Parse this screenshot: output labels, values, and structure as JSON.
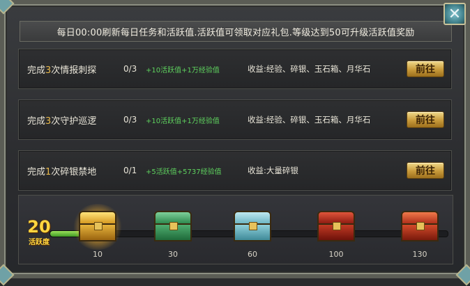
{
  "header": {
    "info_text": "每日00:00刷新每日任务和活跃值.活跃值可领取对应礼包.等级达到50可升级活跃值奖励",
    "close_symbol": "✕"
  },
  "tasks": [
    {
      "prefix": "完成",
      "count": "3",
      "suffix": "次情报刺探",
      "progress": "0/3",
      "reward": "+10活跃值+1万经验值",
      "income": "收益:经验、碎银、玉石箱、月华石",
      "button": "前往"
    },
    {
      "prefix": "完成",
      "count": "3",
      "suffix": "次守护巡逻",
      "progress": "0/3",
      "reward": "+10活跃值+1万经验值",
      "income": "收益:经验、碎银、玉石箱、月华石",
      "button": "前往"
    },
    {
      "prefix": "完成",
      "count": "1",
      "suffix": "次碎银禁地",
      "progress": "0/1",
      "reward": "+5活跃值+5737经验值",
      "income": "收益:大量碎银",
      "button": "前往"
    }
  ],
  "activity": {
    "score": "20",
    "score_label": "活跃度",
    "fill_fraction": 0.12
  },
  "chests": [
    {
      "level": "10",
      "style": "golden-glow"
    },
    {
      "level": "30",
      "style": "jade-green"
    },
    {
      "level": "60",
      "style": "ice-blue"
    },
    {
      "level": "100",
      "style": "crimson"
    },
    {
      "level": "130",
      "style": "crimson-gold"
    }
  ],
  "colors": {
    "reward_text": "#5ed25e",
    "highlight_number": "#e8b84a",
    "button_gold": "#c89a3a",
    "score_yellow": "#ffd640"
  }
}
